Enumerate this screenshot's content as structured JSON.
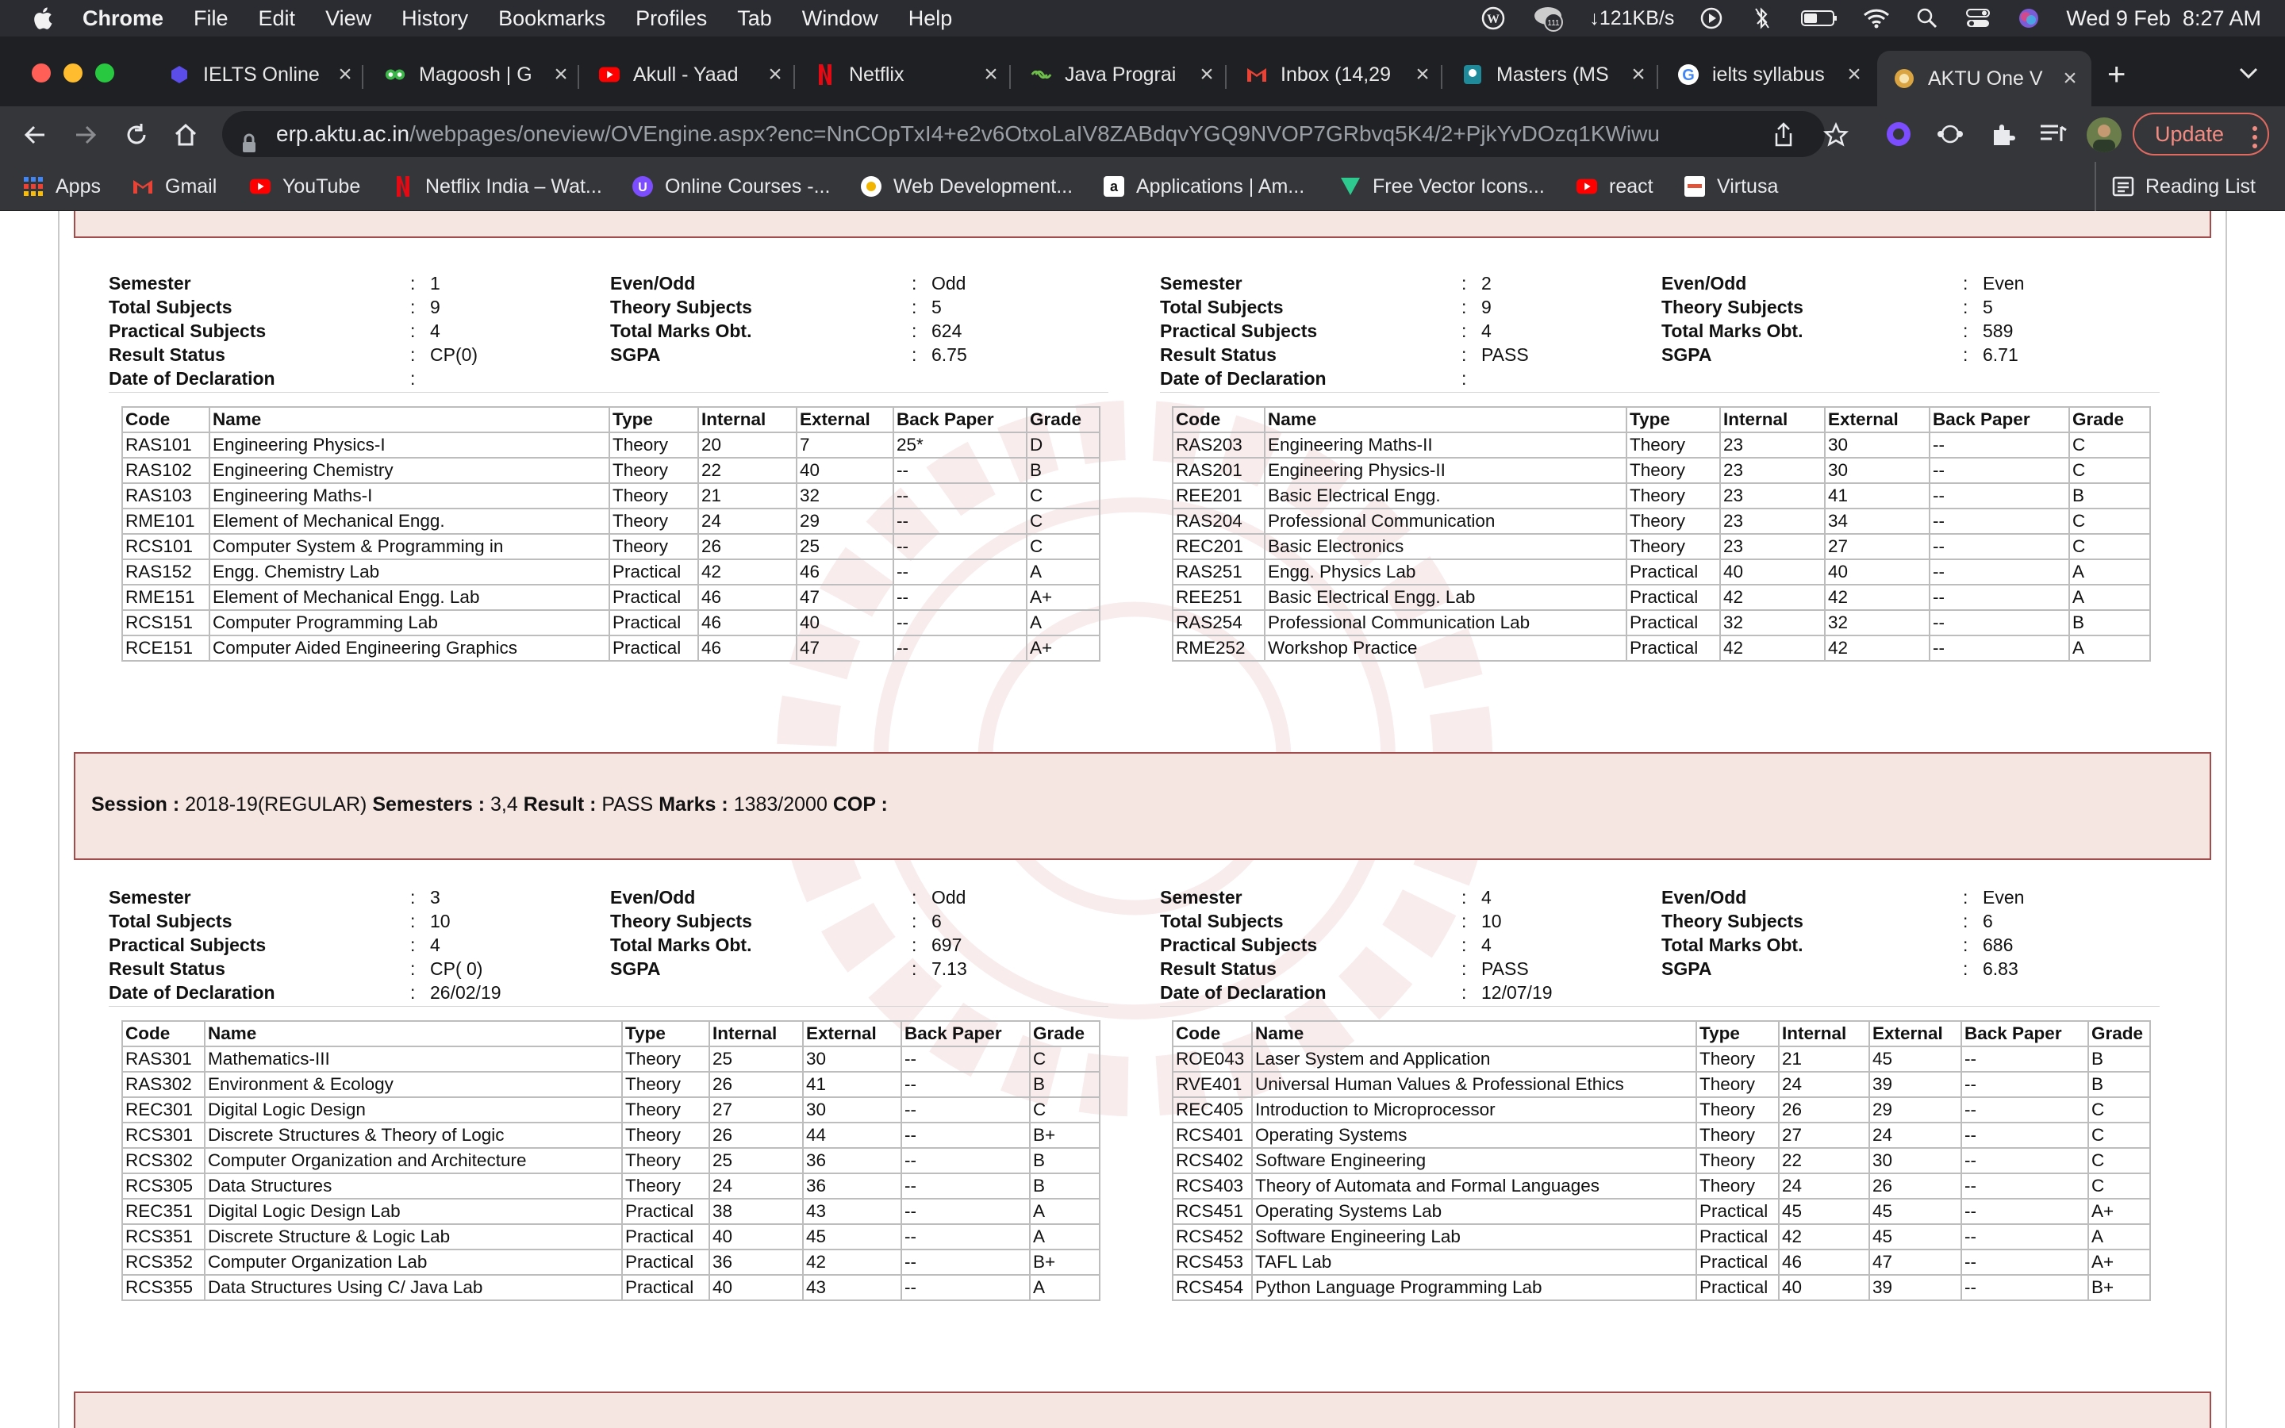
{
  "menubar": {
    "app": "Chrome",
    "items": [
      "File",
      "Edit",
      "View",
      "History",
      "Bookmarks",
      "Profiles",
      "Tab",
      "Window",
      "Help"
    ],
    "network_speed": "↓121KB/s",
    "notif_count": "111",
    "datetime": "Wed 9 Feb  8:27 AM"
  },
  "tabs": [
    {
      "title": "IELTS Online",
      "icon": "ielts-icon"
    },
    {
      "title": "Magoosh | G",
      "icon": "magoosh-icon"
    },
    {
      "title": "Akull - Yaad",
      "icon": "youtube-icon"
    },
    {
      "title": "Netflix",
      "icon": "netflix-icon"
    },
    {
      "title": "Java Prograi",
      "icon": "java-icon"
    },
    {
      "title": "Inbox (14,29",
      "icon": "gmail-icon"
    },
    {
      "title": "Masters (MS",
      "icon": "masters-icon"
    },
    {
      "title": "ielts syllabus",
      "icon": "google-icon"
    },
    {
      "title": "AKTU One V",
      "icon": "aktu-icon"
    }
  ],
  "toolbar": {
    "url_host": "erp.aktu.ac.in",
    "url_path": "/webpages/oneview/OVEngine.aspx?enc=NnCOpTxI4+e2v6OtxoLaIV8ZABdqvYGQ9NVOP7GRbvq5K4/2+PjkYvDOzq1KWiwu",
    "update_label": "Update"
  },
  "bookmarks": {
    "items": [
      "Apps",
      "Gmail",
      "YouTube",
      "Netflix India – Wat...",
      "Online Courses -...",
      "Web Development...",
      "Applications | Am...",
      "Free Vector Icons...",
      "react",
      "Virtusa"
    ],
    "reading_list": "Reading List"
  },
  "info_labels": {
    "semester": "Semester",
    "total_subjects": "Total Subjects",
    "practical_subjects": "Practical Subjects",
    "result_status": "Result Status",
    "date_decl": "Date of Declaration",
    "even_odd": "Even/Odd",
    "theory_subjects": "Theory Subjects",
    "total_marks": "Total Marks Obt.",
    "sgpa": "SGPA",
    "colon": ":"
  },
  "table_headers": [
    "Code",
    "Name",
    "Type",
    "Internal",
    "External",
    "Back Paper",
    "Grade"
  ],
  "session2": {
    "session_label": "Session :",
    "session_value": "2018-19(REGULAR)",
    "semesters_label": "Semesters :",
    "semesters_value": "3,4",
    "result_label": "Result :",
    "result_value": "PASS",
    "marks_label": "Marks :",
    "marks_value": "1383/2000",
    "cop_label": "COP :"
  },
  "semesters": [
    {
      "semester": "1",
      "total_subjects": "9",
      "practical_subjects": "4",
      "result_status": "CP(0)",
      "date_decl": "",
      "even_odd": "Odd",
      "theory_subjects": "5",
      "total_marks": "624",
      "sgpa": "6.75",
      "rows": [
        [
          "RAS101",
          "Engineering Physics-I",
          "Theory",
          "20",
          "7",
          "25*",
          "D"
        ],
        [
          "RAS102",
          "Engineering Chemistry",
          "Theory",
          "22",
          "40",
          "--",
          "B"
        ],
        [
          "RAS103",
          "Engineering Maths-I",
          "Theory",
          "21",
          "32",
          "--",
          "C"
        ],
        [
          "RME101",
          "Element of Mechanical Engg.",
          "Theory",
          "24",
          "29",
          "--",
          "C"
        ],
        [
          "RCS101",
          "Computer System & Programming in",
          "Theory",
          "26",
          "25",
          "--",
          "C"
        ],
        [
          "RAS152",
          "Engg. Chemistry Lab",
          "Practical",
          "42",
          "46",
          "--",
          "A"
        ],
        [
          "RME151",
          "Element of Mechanical Engg. Lab",
          "Practical",
          "46",
          "47",
          "--",
          "A+"
        ],
        [
          "RCS151",
          "Computer Programming Lab",
          "Practical",
          "46",
          "40",
          "--",
          "A"
        ],
        [
          "RCE151",
          "Computer Aided Engineering Graphics",
          "Practical",
          "46",
          "47",
          "--",
          "A+"
        ]
      ]
    },
    {
      "semester": "2",
      "total_subjects": "9",
      "practical_subjects": "4",
      "result_status": "PASS",
      "date_decl": "",
      "even_odd": "Even",
      "theory_subjects": "5",
      "total_marks": "589",
      "sgpa": "6.71",
      "rows": [
        [
          "RAS203",
          "Engineering Maths-II",
          "Theory",
          "23",
          "30",
          "--",
          "C"
        ],
        [
          "RAS201",
          "Engineering Physics-II",
          "Theory",
          "23",
          "30",
          "--",
          "C"
        ],
        [
          "REE201",
          "Basic Electrical Engg.",
          "Theory",
          "23",
          "41",
          "--",
          "B"
        ],
        [
          "RAS204",
          "Professional Communication",
          "Theory",
          "23",
          "34",
          "--",
          "C"
        ],
        [
          "REC201",
          "Basic Electronics",
          "Theory",
          "23",
          "27",
          "--",
          "C"
        ],
        [
          "RAS251",
          "Engg. Physics Lab",
          "Practical",
          "40",
          "40",
          "--",
          "A"
        ],
        [
          "REE251",
          "Basic Electrical Engg. Lab",
          "Practical",
          "42",
          "42",
          "--",
          "A"
        ],
        [
          "RAS254",
          "Professional Communication Lab",
          "Practical",
          "32",
          "32",
          "--",
          "B"
        ],
        [
          "RME252",
          "Workshop Practice",
          "Practical",
          "42",
          "42",
          "--",
          "A"
        ]
      ]
    },
    {
      "semester": "3",
      "total_subjects": "10",
      "practical_subjects": "4",
      "result_status": "CP( 0)",
      "date_decl": "26/02/19",
      "even_odd": "Odd",
      "theory_subjects": "6",
      "total_marks": "697",
      "sgpa": "7.13",
      "rows": [
        [
          "RAS301",
          "Mathematics-III",
          "Theory",
          "25",
          "30",
          "--",
          "C"
        ],
        [
          "RAS302",
          "Environment &  Ecology",
          "Theory",
          "26",
          "41",
          "--",
          "B"
        ],
        [
          "REC301",
          "Digital Logic Design",
          "Theory",
          "27",
          "30",
          "--",
          "C"
        ],
        [
          "RCS301",
          "Discrete Structures & Theory of Logic",
          "Theory",
          "26",
          "44",
          "--",
          "B+"
        ],
        [
          "RCS302",
          "Computer Organization and  Architecture",
          "Theory",
          "25",
          "36",
          "--",
          "B"
        ],
        [
          "RCS305",
          "Data Structures",
          "Theory",
          "24",
          "36",
          "--",
          "B"
        ],
        [
          "REC351",
          "Digital Logic Design Lab",
          "Practical",
          "38",
          "43",
          "--",
          "A"
        ],
        [
          "RCS351",
          "Discrete Structure & Logic Lab",
          "Practical",
          "40",
          "45",
          "--",
          "A"
        ],
        [
          "RCS352",
          "Computer Organization Lab",
          "Practical",
          "36",
          "42",
          "--",
          "B+"
        ],
        [
          "RCS355",
          "Data Structures Using C/ Java Lab",
          "Practical",
          "40",
          "43",
          "--",
          "A"
        ]
      ]
    },
    {
      "semester": "4",
      "total_subjects": "10",
      "practical_subjects": "4",
      "result_status": "PASS",
      "date_decl": "12/07/19",
      "even_odd": "Even",
      "theory_subjects": "6",
      "total_marks": "686",
      "sgpa": "6.83",
      "rows": [
        [
          "ROE043",
          "Laser System and Application",
          "Theory",
          "21",
          "45",
          "--",
          "B"
        ],
        [
          "RVE401",
          "Universal Human Values & Professional Ethics",
          "Theory",
          "24",
          "39",
          "--",
          "B"
        ],
        [
          "REC405",
          "Introduction to Microprocessor",
          "Theory",
          "26",
          "29",
          "--",
          "C"
        ],
        [
          "RCS401",
          "Operating Systems",
          "Theory",
          "27",
          "24",
          "--",
          "C"
        ],
        [
          "RCS402",
          "Software Engineering",
          "Theory",
          "22",
          "30",
          "--",
          "C"
        ],
        [
          "RCS403",
          "Theory of Automata and Formal Languages",
          "Theory",
          "24",
          "26",
          "--",
          "C"
        ],
        [
          "RCS451",
          "Operating Systems Lab",
          "Practical",
          "45",
          "45",
          "--",
          "A+"
        ],
        [
          "RCS452",
          "Software Engineering Lab",
          "Practical",
          "42",
          "45",
          "--",
          "A"
        ],
        [
          "RCS453",
          "TAFL Lab",
          "Practical",
          "46",
          "47",
          "--",
          "A+"
        ],
        [
          "RCS454",
          "Python Language Programming Lab",
          "Practical",
          "40",
          "39",
          "--",
          "B+"
        ]
      ]
    }
  ]
}
